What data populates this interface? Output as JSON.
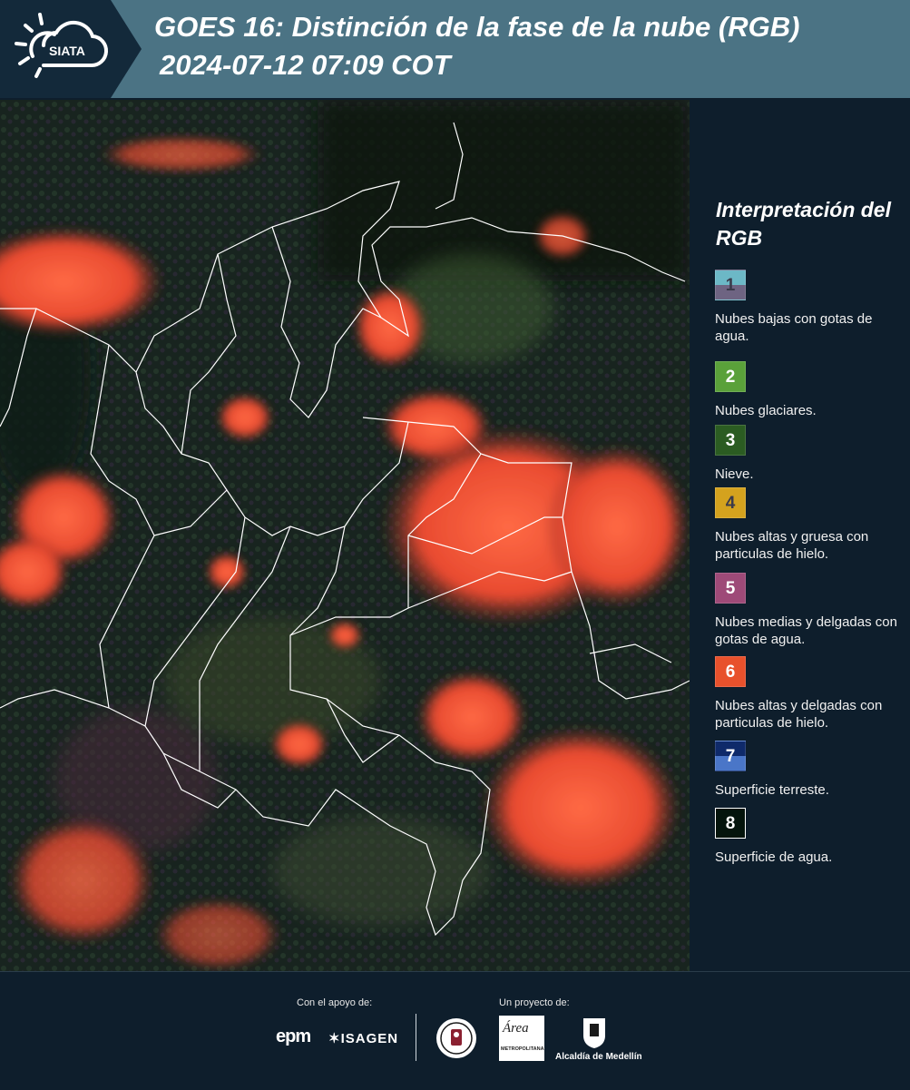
{
  "header": {
    "logo_text": "SIATA",
    "title_line1": "GOES 16: Distinción de la fase de la nube (RGB)",
    "title_line2": "2024-07-12 07:09 COT",
    "background_color": "#4b7384",
    "logo_icon": "sun-cloud-icon"
  },
  "map": {
    "description_icon": "satellite-rgb-map",
    "cloud_color": "#ff5a3c",
    "ground_color": "#1d2a22",
    "border_color": "#ffffff"
  },
  "legend": {
    "title": "Interpretación del RGB",
    "items": [
      {
        "number": "1",
        "label": "Nubes bajas con gotas de agua.",
        "color_top": "#6cb8c6",
        "color_bottom": "#6e6482"
      },
      {
        "number": "2",
        "label": "Nubes glaciares.",
        "color_top": "#5aa13a",
        "color_bottom": "#5aa13a"
      },
      {
        "number": "3",
        "label": "Nieve.",
        "color_top": "#2b5c22",
        "color_bottom": "#2b5c22"
      },
      {
        "number": "4",
        "label": "Nubes altas y gruesa con particulas de hielo.",
        "color_top": "#d4a21e",
        "color_bottom": "#d4a21e"
      },
      {
        "number": "5",
        "label": "Nubes medias y delgadas con gotas de agua.",
        "color_top": "#9e4a78",
        "color_bottom": "#9e4a78"
      },
      {
        "number": "6",
        "label": "Nubes altas y delgadas con particulas de hielo.",
        "color_top": "#e8512c",
        "color_bottom": "#e8512c"
      },
      {
        "number": "7",
        "label": "Superficie terreste.",
        "color_top": "#0f2a6a",
        "color_bottom": "#4a76c8"
      },
      {
        "number": "8",
        "label": "Superficie de agua.",
        "color_top": "#04140c",
        "color_bottom": "#04140c"
      }
    ]
  },
  "footer": {
    "support_label": "Con el apoyo de:",
    "project_label": "Un proyecto de:",
    "epm_logo_text": "epm",
    "isagen_logo_text": "ISAGEN",
    "area_logo_text": "Área",
    "area_logo_subtext": "METROPOLITANA",
    "alcaldia_text": "Alcaldía de Medellín"
  }
}
